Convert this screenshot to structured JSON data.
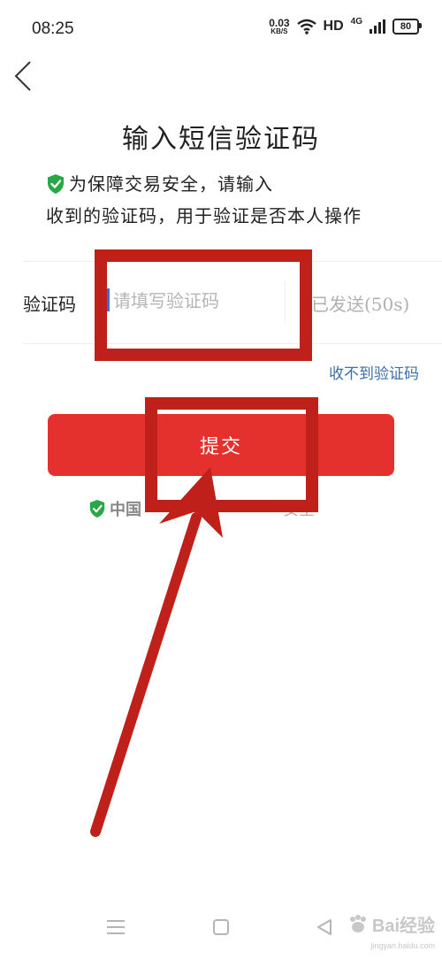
{
  "status_bar": {
    "time": "08:25",
    "net_speed_value": "0.03",
    "net_speed_unit": "KB/S",
    "hd": "HD",
    "network": "4G",
    "battery": "80"
  },
  "page": {
    "title": "输入短信验证码",
    "notice_line1": "为保障交易安全，请输入",
    "notice_line2": "收到的验证码，用于验证是否本人操作"
  },
  "form": {
    "code_label": "验证码",
    "code_value": "",
    "code_placeholder": "请填写验证码",
    "resend_label": "已发送(50s)",
    "no_code_link": "收不到验证码",
    "submit_label": "提交"
  },
  "security_note": {
    "brand": "中国",
    "text": "安全"
  },
  "watermark": {
    "text": "Bai经验",
    "sub": "jingyan.baidu.com"
  },
  "colors": {
    "accent_red": "#e5312d",
    "annotation_red": "#c0201a",
    "shield_green": "#27a844",
    "link_blue": "#3d6fa6"
  },
  "icons": {
    "back": "chevron-left-icon",
    "shield": "shield-check-icon",
    "wifi": "wifi-icon",
    "signal": "signal-bars-icon",
    "battery": "battery-icon",
    "nav_menu": "menu-lines-icon",
    "nav_home": "square-home-icon",
    "nav_back": "triangle-back-icon"
  }
}
